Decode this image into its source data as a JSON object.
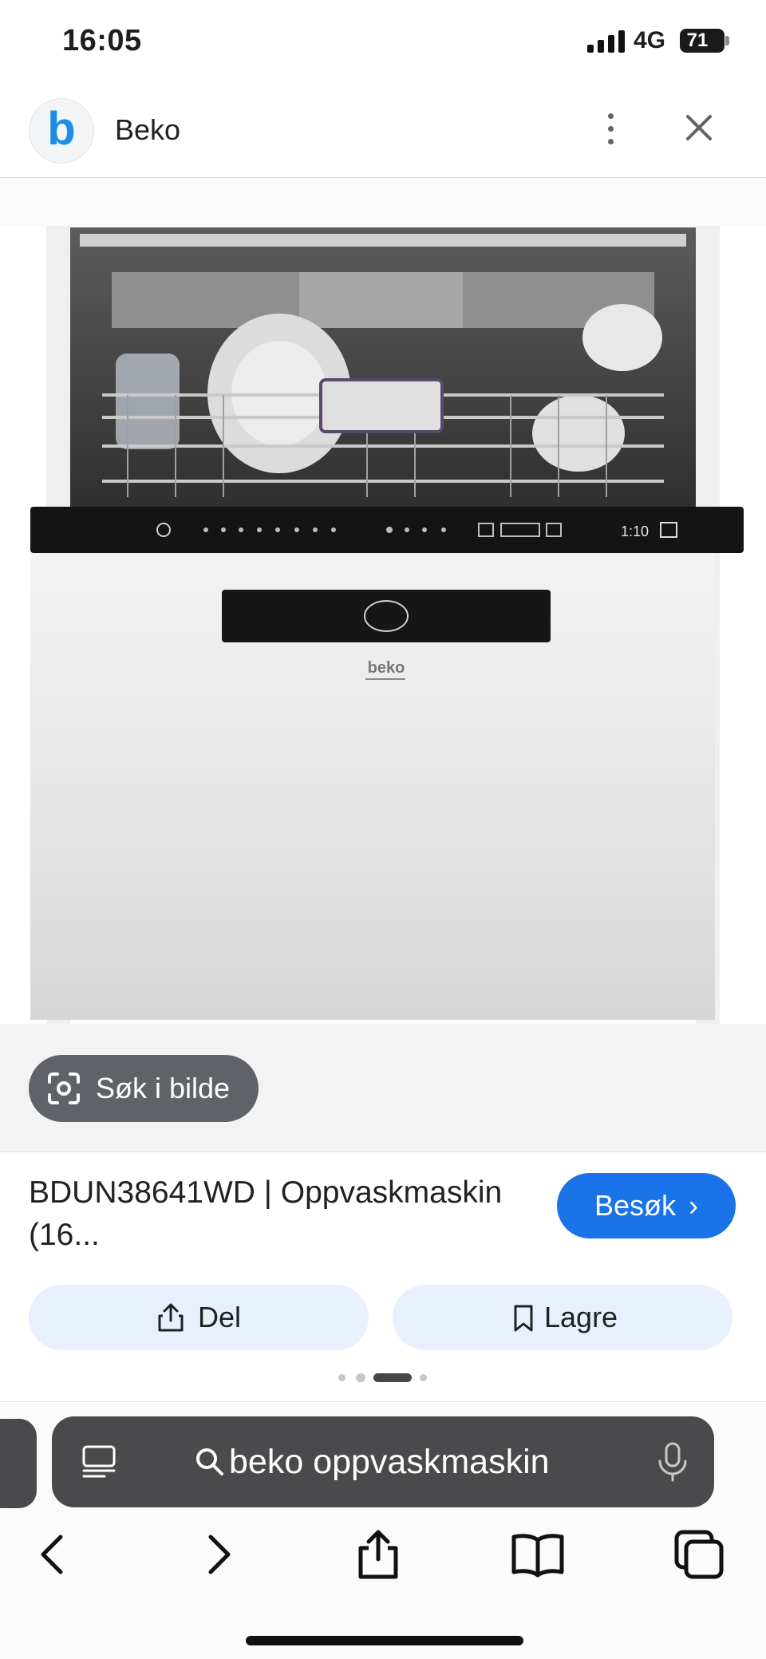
{
  "status_bar": {
    "time": "16:05",
    "network": "4G",
    "battery": "71"
  },
  "header": {
    "site_logo_letter": "b",
    "site_name": "Beko",
    "logo_color": "#1d8ee6"
  },
  "image": {
    "lens_chip_label": "Søk i bilde",
    "product_brand_on_door": "beko",
    "display_time": "1:10"
  },
  "result": {
    "title": "BDUN38641WD | Oppvaskmaskin (16...",
    "visit_label": "Besøk",
    "share_label": "Del",
    "save_label": "Lagre",
    "accent_color": "#1a73e8"
  },
  "pager": {
    "count": 4,
    "active_index": 2
  },
  "browser": {
    "search_query": "beko oppvaskmaskin",
    "toolbar_icons": [
      "back-icon",
      "forward-icon",
      "share-icon",
      "bookmarks-icon",
      "tabs-icon"
    ]
  }
}
